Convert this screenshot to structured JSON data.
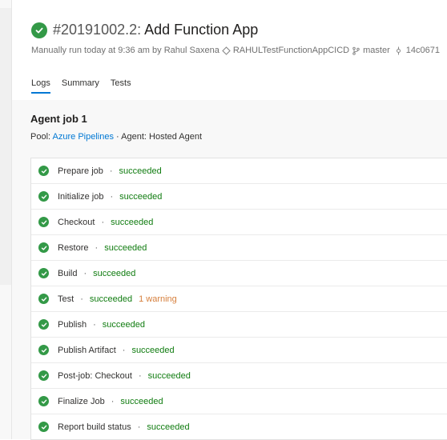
{
  "build": {
    "number": "#20191002.2:",
    "name": "Add Function App",
    "run_info": "Manually run today at 9:36 am by Rahul Saxena",
    "repo": "RAHULTestFunctionAppCICD",
    "branch": "master",
    "commit": "14c0671"
  },
  "tabs": [
    "Logs",
    "Summary",
    "Tests"
  ],
  "job": {
    "title": "Agent job 1",
    "pool_label": "Pool:",
    "pool_link": "Azure Pipelines",
    "agent_text": "· Agent: Hosted Agent"
  },
  "steps": [
    {
      "name": "Prepare job",
      "status": "succeeded"
    },
    {
      "name": "Initialize job",
      "status": "succeeded"
    },
    {
      "name": "Checkout",
      "status": "succeeded"
    },
    {
      "name": "Restore",
      "status": "succeeded"
    },
    {
      "name": "Build",
      "status": "succeeded"
    },
    {
      "name": "Test",
      "status": "succeeded",
      "warning": "1 warning"
    },
    {
      "name": "Publish",
      "status": "succeeded"
    },
    {
      "name": "Publish Artifact",
      "status": "succeeded"
    },
    {
      "name": "Post-job: Checkout",
      "status": "succeeded"
    },
    {
      "name": "Finalize Job",
      "status": "succeeded"
    },
    {
      "name": "Report build status",
      "status": "succeeded"
    }
  ],
  "separator": "·",
  "colors": {
    "success": "#339947",
    "accent": "#0078d4",
    "warning": "#d67f3c"
  }
}
